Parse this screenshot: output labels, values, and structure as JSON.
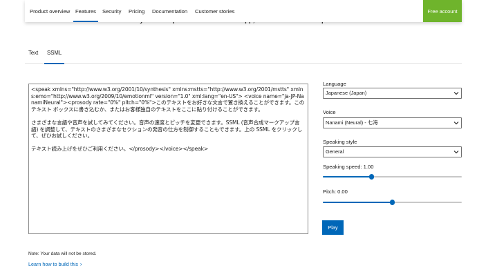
{
  "nav": {
    "items": [
      "Product overview",
      "Features",
      "Security",
      "Pricing",
      "Documentation",
      "Customer stories"
    ],
    "active": "Features",
    "cta": "Free account"
  },
  "page": {
    "subtitle_partial": "Try Text to Speech with this demo app, built on our JavaScript SDK"
  },
  "tabs": {
    "items": [
      "Text",
      "SSML"
    ],
    "active": "SSML"
  },
  "editor": {
    "paragraphs": [
      "<speak xmlns=\"http://www.w3.org/2001/10/synthesis\" xmlns:mstts=\"http://www.w3.org/2001/mstts\" xmlns:emo=\"http://www.w3.org/2009/10/emotionml\" version=\"1.0\" xml:lang=\"en-US\"> <voice name=\"ja-JP-NanamiNeural\"><prosody rate=\"0%\" pitch=\"0%\">このテキストをお好きな文言で置き換えることができます。このテキスト ボックスに書き込むか、またはお客様独自のテキストをここに貼り付けることができます。",
      "さまざまな言語や音声を試してみてください。音声の速度とピッチを変更できます。SSML (音声合成マークアップ言語) を調整して、テキストのさまざまなセクションの発音の仕方を制御することもできます。上の SSML をクリックして、ぜひお試しください。",
      "テキスト読み上げをぜひご利用ください。</prosody></voice></speak>"
    ]
  },
  "controls": {
    "language": {
      "label": "Language",
      "value": "Japanese (Japan)"
    },
    "voice": {
      "label": "Voice",
      "value": "Nanami (Neural) - 七海"
    },
    "style": {
      "label": "Speaking style",
      "value": "General"
    },
    "speed": {
      "label": "Speaking speed: 1.00",
      "value": 1.0,
      "fraction": 0.35
    },
    "pitch": {
      "label": "Pitch: 0.00",
      "value": 0.0,
      "fraction": 0.5
    },
    "play": "Play"
  },
  "footer": {
    "note": "Note: Your data will not be stored.",
    "link": "Learn how to build this"
  },
  "icons": {
    "select_chevron": "chevron-down-icon",
    "link_chevron": "chevron-right-icon"
  },
  "colors": {
    "accent": "#0067b8",
    "cta": "#6fb42c"
  }
}
